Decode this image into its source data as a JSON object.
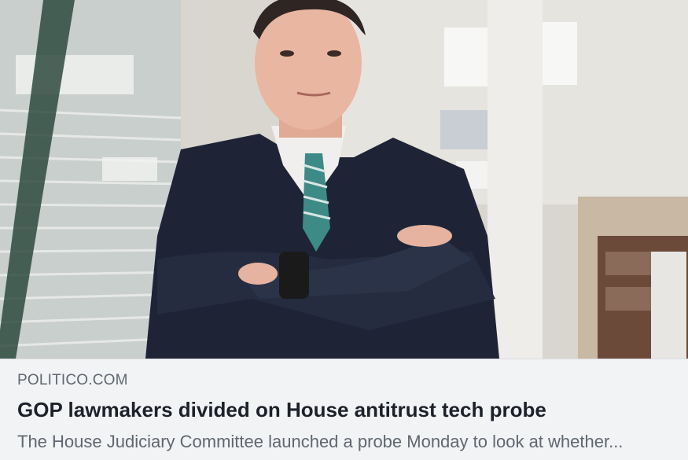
{
  "link_preview": {
    "domain": "POLITICO.COM",
    "headline": "GOP lawmakers divided on House antitrust tech probe",
    "description": "The House Judiciary Committee launched a probe Monday to look at whether..."
  },
  "photo": {
    "icon": "news-photo"
  },
  "colors": {
    "meta_background": "#f2f3f5",
    "headline": "#1d2129",
    "secondary_text": "#606770"
  }
}
